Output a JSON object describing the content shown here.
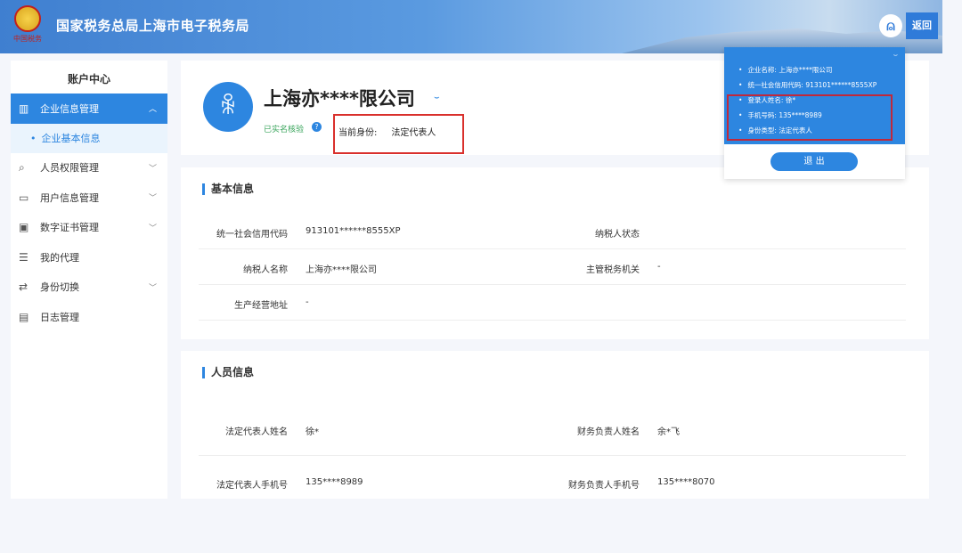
{
  "header": {
    "title": "国家税务总局上海市电子税务局",
    "logo_text": "中国税务",
    "back_label": "返回"
  },
  "sidebar": {
    "title": "账户中心",
    "items": [
      {
        "label": "企业信息管理",
        "icon": "building-icon",
        "expanded": true
      },
      {
        "label": "人员权限管理",
        "icon": "user-search-icon"
      },
      {
        "label": "用户信息管理",
        "icon": "user-card-icon"
      },
      {
        "label": "数字证书管理",
        "icon": "certificate-icon"
      },
      {
        "label": "我的代理",
        "icon": "document-icon"
      },
      {
        "label": "身份切换",
        "icon": "switch-icon"
      },
      {
        "label": "日志管理",
        "icon": "log-icon"
      }
    ],
    "sub_item": "企业基本信息"
  },
  "profile": {
    "company": "上海亦****限公司",
    "verified": "已实名核验",
    "identity_label": "当前身份:",
    "identity_value": "法定代表人"
  },
  "basic": {
    "title": "基本信息",
    "fields": [
      {
        "label": "统一社会信用代码",
        "value": "913101******8555XP"
      },
      {
        "label": "纳税人状态",
        "value": ""
      },
      {
        "label": "纳税人名称",
        "value": "上海亦****限公司"
      },
      {
        "label": "主管税务机关",
        "value": "-"
      },
      {
        "label": "生产经营地址",
        "value": "-"
      }
    ]
  },
  "people": {
    "title": "人员信息",
    "fields": [
      {
        "label": "法定代表人姓名",
        "value": "徐*"
      },
      {
        "label": "财务负责人姓名",
        "value": "余*飞"
      },
      {
        "label": "法定代表人手机号",
        "value": "135****8989"
      },
      {
        "label": "财务负责人手机号",
        "value": "135****8070"
      }
    ]
  },
  "popup": {
    "lines": [
      "企业名称: 上海亦****限公司",
      "统一社会信用代码: 913101******8555XP",
      "登录人姓名: 徐*",
      "手机号码: 135****8989",
      "身份类型: 法定代表人"
    ],
    "logout": "退 出"
  }
}
